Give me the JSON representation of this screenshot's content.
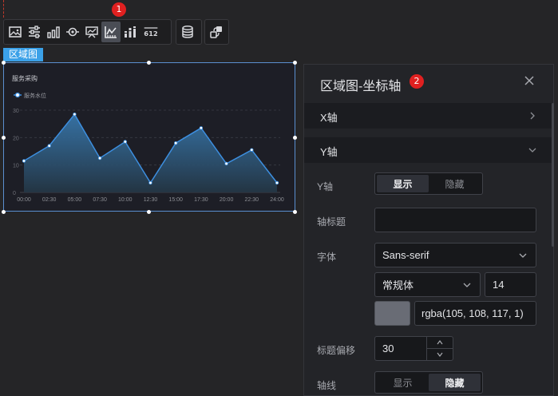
{
  "toolbar": {
    "icons": [
      "image-icon",
      "sliders-icon",
      "bar-chart-icon",
      "eye-target-icon",
      "presentation-icon",
      "area-chart-icon",
      "stacked-bar-icon",
      "number-icon",
      "database-icon",
      "link-icon"
    ],
    "number_icon_text": "612",
    "active_icon": "area-chart-icon"
  },
  "badges": {
    "one": "1",
    "two": "2"
  },
  "component_label": "区域图",
  "chart_data": {
    "type": "area",
    "title": "服务采购",
    "legend": [
      "服务水位"
    ],
    "x": [
      "00:00",
      "02:30",
      "05:00",
      "07:30",
      "10:00",
      "12:30",
      "15:00",
      "17:30",
      "20:00",
      "22:30",
      "24:00"
    ],
    "x_points": [
      "00:00",
      "01:15",
      "02:30",
      "03:45",
      "05:00",
      "06:15",
      "07:30",
      "08:45",
      "10:00",
      "11:15",
      "12:30"
    ],
    "values": [
      11.5,
      17,
      28.5,
      12.5,
      18.5,
      3.5,
      18,
      23.5,
      10.5,
      15.5,
      3.5
    ],
    "y_ticks": [
      0,
      10,
      20,
      30
    ],
    "ylim": [
      0,
      30
    ],
    "grid": true,
    "color": "#3d8fe0"
  },
  "panel": {
    "title": "区域图-坐标轴",
    "sections": {
      "x_axis": "X轴",
      "y_axis": "Y轴"
    },
    "y_axis_label": "Y轴",
    "show": "显示",
    "hide": "隐藏",
    "axis_title_label": "轴标题",
    "axis_title_value": "",
    "font_label": "字体",
    "font_family": "Sans-serif",
    "font_style": "常规体",
    "font_size": "14",
    "color_value": "rgba(105, 108, 117, 1)",
    "title_offset_label": "标题偏移",
    "title_offset": "30",
    "axis_line_label": "轴线"
  }
}
